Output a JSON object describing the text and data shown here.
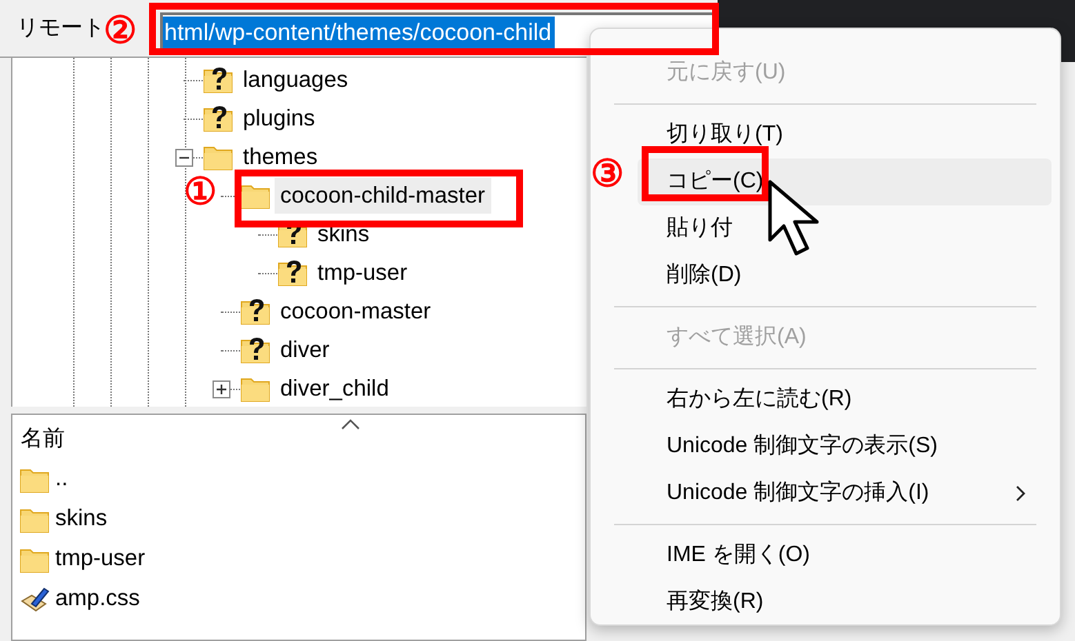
{
  "remote_pane": {
    "label": "リモート",
    "path": "html/wp-content/themes/cocoon-child",
    "tree": [
      {
        "label": "languages",
        "kind": "unknown",
        "selected": false
      },
      {
        "label": "plugins",
        "kind": "unknown",
        "selected": false
      },
      {
        "label": "themes",
        "kind": "folder",
        "selected": false,
        "expanded": true,
        "children": [
          {
            "label": "cocoon-child-master",
            "kind": "folder",
            "selected": true,
            "children": [
              {
                "label": "skins",
                "kind": "unknown",
                "selected": false
              },
              {
                "label": "tmp-user",
                "kind": "unknown",
                "selected": false
              }
            ]
          },
          {
            "label": "cocoon-master",
            "kind": "unknown",
            "selected": false
          },
          {
            "label": "diver",
            "kind": "unknown",
            "selected": false
          },
          {
            "label": "diver_child",
            "kind": "folder",
            "selected": false,
            "expanded": false
          }
        ]
      }
    ]
  },
  "file_list": {
    "column": "名前",
    "rows": [
      {
        "name": "..",
        "kind": "folder"
      },
      {
        "name": "skins",
        "kind": "folder"
      },
      {
        "name": "tmp-user",
        "kind": "folder"
      },
      {
        "name": "amp.css",
        "kind": "css"
      }
    ]
  },
  "context_menu": {
    "items": [
      {
        "kind": "item",
        "label": "元に戻す(U)",
        "disabled": true,
        "highlighted": false
      },
      {
        "kind": "separator"
      },
      {
        "kind": "item",
        "label": "切り取り(T)",
        "disabled": false,
        "highlighted": false
      },
      {
        "kind": "item",
        "label": "コピー(C)",
        "disabled": false,
        "highlighted": true
      },
      {
        "kind": "item",
        "label": "貼り付",
        "disabled": false,
        "highlighted": false
      },
      {
        "kind": "item",
        "label": "削除(D)",
        "disabled": false,
        "highlighted": false
      },
      {
        "kind": "separator"
      },
      {
        "kind": "item",
        "label": "すべて選択(A)",
        "disabled": true,
        "highlighted": false
      },
      {
        "kind": "separator"
      },
      {
        "kind": "item",
        "label": "右から左に読む(R)",
        "disabled": false,
        "highlighted": false
      },
      {
        "kind": "item",
        "label": "Unicode 制御文字の表示(S)",
        "disabled": false,
        "highlighted": false
      },
      {
        "kind": "submenu",
        "label": "Unicode 制御文字の挿入(I)",
        "disabled": false,
        "highlighted": false
      },
      {
        "kind": "separator"
      },
      {
        "kind": "item",
        "label": "IME を開く(O)",
        "disabled": false,
        "highlighted": false
      },
      {
        "kind": "item",
        "label": "再変換(R)",
        "disabled": false,
        "highlighted": false
      }
    ]
  },
  "annotations": [
    {
      "number": "①"
    },
    {
      "number": "②"
    },
    {
      "number": "③"
    }
  ]
}
